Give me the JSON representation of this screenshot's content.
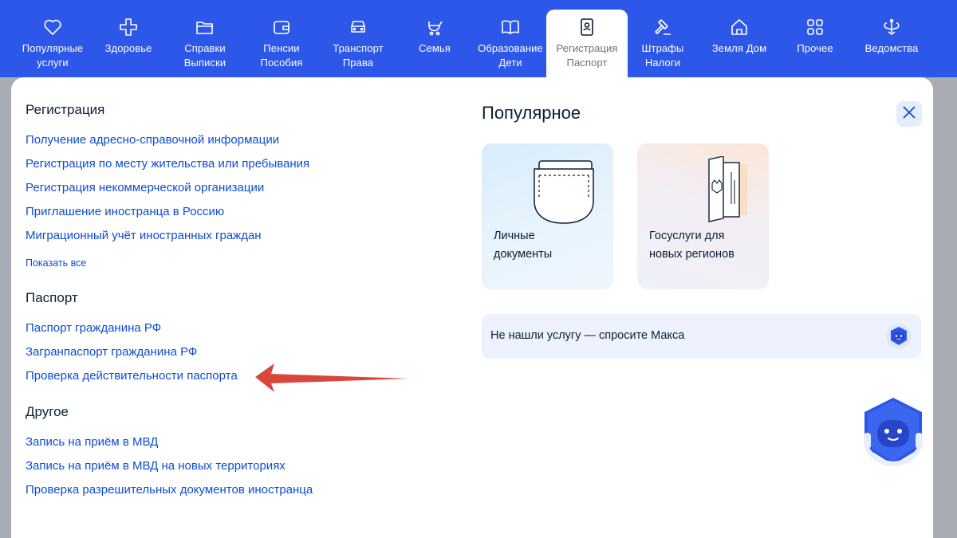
{
  "colors": {
    "nav_bg": "#2d57e8",
    "link": "#0d4cd3",
    "text": "#0b1f33",
    "overlay": "#a9acb3",
    "arrow": "#d9463e"
  },
  "nav": {
    "items": [
      {
        "icon": "heart-icon",
        "label": "Популярные\nуслуги"
      },
      {
        "icon": "plus-cross-icon",
        "label": "Здоровье"
      },
      {
        "icon": "folder-icon",
        "label": "Справки\nВыписки"
      },
      {
        "icon": "wallet-icon",
        "label": "Пенсии\nПособия"
      },
      {
        "icon": "car-icon",
        "label": "Транспорт\nПрава"
      },
      {
        "icon": "stroller-icon",
        "label": "Семья"
      },
      {
        "icon": "book-icon",
        "label": "Образование\nДети"
      },
      {
        "icon": "id-badge-icon",
        "label": "Регистрация\nПаспорт",
        "active": true
      },
      {
        "icon": "gavel-icon",
        "label": "Штрафы\nНалоги"
      },
      {
        "icon": "house-icon",
        "label": "Земля Дом"
      },
      {
        "icon": "grid-icon",
        "label": "Прочее"
      },
      {
        "icon": "emblem-icon",
        "label": "Ведомства"
      }
    ]
  },
  "sections": {
    "registration": {
      "title": "Регистрация",
      "links": [
        "Получение адресно-справочной информации",
        "Регистрация по месту жительства или пребывания",
        "Регистрация некоммерческой организации",
        "Приглашение иностранца в Россию",
        "Миграционный учёт иностранных граждан"
      ],
      "show_all": "Показать все"
    },
    "passport": {
      "title": "Паспорт",
      "links": [
        "Паспорт гражданина РФ",
        "Загранпаспорт гражданина РФ",
        "Проверка действительности паспорта"
      ]
    },
    "other": {
      "title": "Другое",
      "links": [
        "Запись на приём в МВД",
        "Запись на приём в МВД на новых территориях",
        "Проверка разрешительных документов иностранца"
      ]
    }
  },
  "popular": {
    "title": "Популярное",
    "cards": [
      {
        "label": "Личные\nдокументы",
        "icon": "documents-pocket-icon"
      },
      {
        "label": "Госуслуги для\nновых регионов",
        "icon": "passport-book-icon"
      }
    ],
    "ask": "Не нашли услугу — спросите Макса"
  }
}
